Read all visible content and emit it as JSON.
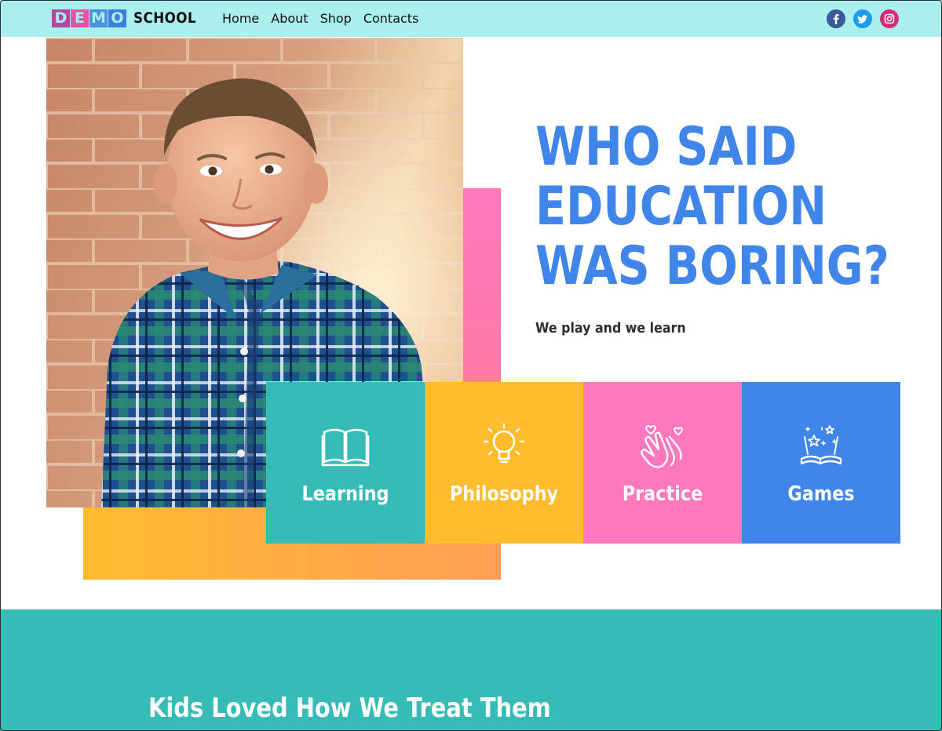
{
  "nav": {
    "logo_letters": [
      "D",
      "E",
      "M",
      "O"
    ],
    "logo_letter_colors": [
      "#b04aa0",
      "#e4539f",
      "#4a8fe0",
      "#3d7fe0"
    ],
    "logo_word": "SCHOOL",
    "links": [
      "Home",
      "About",
      "Shop",
      "Contacts"
    ],
    "social": [
      {
        "icon": "facebook-icon",
        "color": "#3b5998"
      },
      {
        "icon": "twitter-icon",
        "color": "#1d9bf0"
      },
      {
        "icon": "instagram-icon",
        "color": "#d62976"
      }
    ]
  },
  "hero": {
    "headline_lines": [
      "WHO SAID",
      "EDUCATION",
      "WAS BORING?"
    ],
    "subtitle": "We play and we learn",
    "headline_color": "#3f85ea"
  },
  "cards": [
    {
      "label": "Learning",
      "icon": "book-icon",
      "color": "#36bbb7"
    },
    {
      "label": "Philosophy",
      "icon": "lightbulb-icon",
      "color": "#ffbd2e"
    },
    {
      "label": "Practice",
      "icon": "clapping-hands-icon",
      "color": "#ff78bd"
    },
    {
      "label": "Games",
      "icon": "magic-book-icon",
      "color": "#3f85ea"
    }
  ],
  "section": {
    "heading": "Kids Loved How We Treat Them",
    "background": "#36bbb7"
  }
}
